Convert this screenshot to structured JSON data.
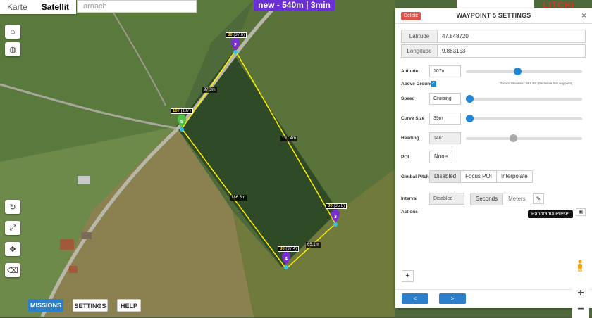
{
  "map": {
    "type_buttons": [
      {
        "label": "Karte"
      },
      {
        "label": "Satellit"
      }
    ],
    "search_placeholder": "arnach",
    "mission_banner": "new - 540m | 3min",
    "left_tools": [
      {
        "name": "home-icon",
        "glyph": "⌂"
      },
      {
        "name": "globe-icon",
        "glyph": "◍"
      },
      {
        "name": "refresh-icon",
        "glyph": "↻"
      },
      {
        "name": "resize-icon",
        "glyph": "⤢"
      },
      {
        "name": "move-icon",
        "glyph": "✥"
      },
      {
        "name": "eraser-icon",
        "glyph": "⌫"
      }
    ],
    "bottom_buttons": {
      "missions": "MISSIONS",
      "settings": "SETTINGS",
      "help": "HELP"
    },
    "segments": [
      "97.3m",
      "197.4m",
      "186.5m",
      "65.1m"
    ],
    "waypoints": [
      {
        "num": "2",
        "label_alt": "30",
        "label_val": "(37.6)",
        "color": "#7b2fd0"
      },
      {
        "num": "5",
        "label_alt": "107",
        "label_val": "(107)",
        "color": "#4ec243"
      },
      {
        "num": "3",
        "label_alt": "30",
        "label_val": "(35.8)",
        "color": "#7b2fd0"
      },
      {
        "num": "4",
        "label_alt": "30",
        "label_val": "(37.4)",
        "color": "#7b2fd0"
      }
    ],
    "zoom_in": "+",
    "zoom_out": "−"
  },
  "panel": {
    "title": "WAYPOINT 5 SETTINGS",
    "delete_label": "Delete",
    "close_label": "×",
    "latitude_label": "Latitude",
    "latitude_value": "47.848720",
    "longitude_label": "Longitude",
    "longitude_value": "9.883153",
    "altitude_label": "Altitude",
    "altitude_value": "107m",
    "altitude_level": 0.44,
    "above_ground_label": "Above Ground",
    "above_ground_checked": true,
    "ground_note": "Ground Elevation: 681.3m (0m below first waypoint)",
    "speed_label": "Speed",
    "speed_value": "Cruising",
    "speed_level": 0.0,
    "curve_label": "Curve Size",
    "curve_value": "39m",
    "curve_level": 0.0,
    "heading_label": "Heading",
    "heading_value": "146°",
    "heading_level": 0.4,
    "poi_label": "POI",
    "poi_value": "None",
    "gimbal_label": "Gimbal Pitch",
    "gimbal_options": [
      "Disabled",
      "Focus POI",
      "Interpolate"
    ],
    "interval_label": "Interval",
    "interval_value": "Disabled",
    "interval_units": [
      "Seconds",
      "Meters"
    ],
    "actions_label": "Actions",
    "tooltip": "Panorama Preset",
    "add_label": "+",
    "prev_label": "<",
    "next_label": ">"
  },
  "colors": {
    "accent": "#2e7fc9",
    "banner": "#6b2fd6",
    "delete": "#d9534f",
    "path": "#ffee00"
  }
}
